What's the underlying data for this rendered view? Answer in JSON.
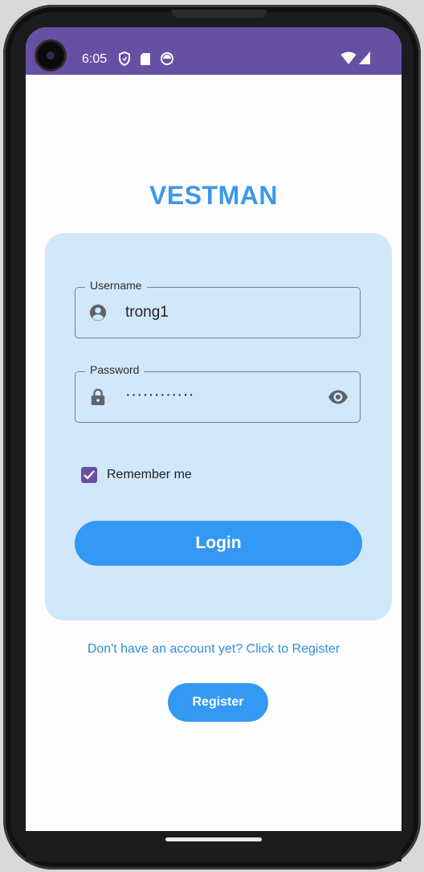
{
  "status_bar": {
    "time": "6:05",
    "left_icons": [
      "shield-icon",
      "sd-card-icon",
      "sync-circle-icon"
    ],
    "right_icons": [
      "wifi-icon",
      "cellular-signal-icon"
    ],
    "background_color": "#6750a4"
  },
  "app": {
    "title": "VESTMAN",
    "title_color": "#3d98e8"
  },
  "login_card": {
    "background_color": "#d1e8fb",
    "username": {
      "label": "Username",
      "value": "trong1",
      "icon": "account-circle-icon"
    },
    "password": {
      "label": "Password",
      "value": "············",
      "icon": "lock-icon",
      "visibility_icon": "eye-icon"
    },
    "remember_me": {
      "label": "Remember me",
      "checked": true
    },
    "login_button": {
      "label": "Login",
      "color": "#3399f3"
    }
  },
  "register": {
    "prompt": "Don't have an account yet? Click to Register",
    "button_label": "Register"
  }
}
